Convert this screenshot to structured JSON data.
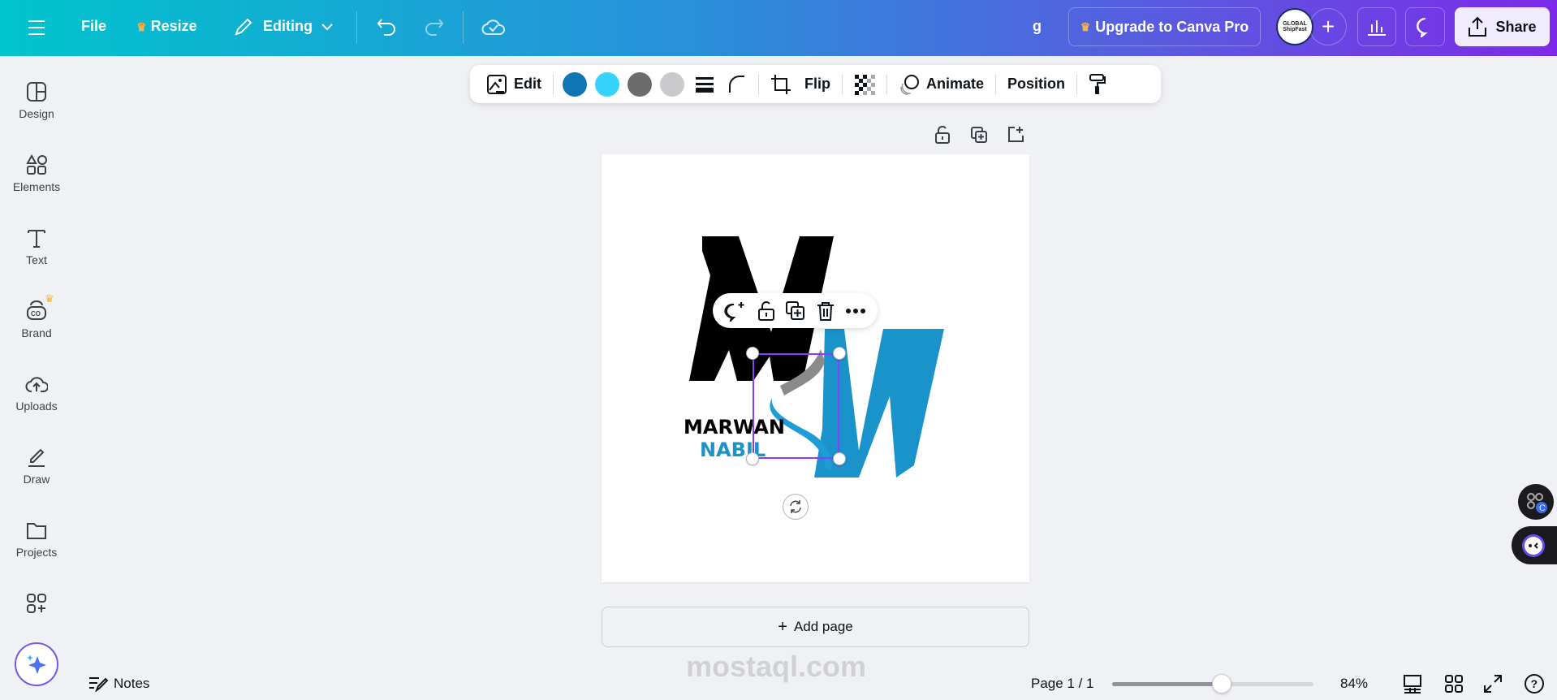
{
  "header": {
    "file": "File",
    "resize": "Resize",
    "editing": "Editing",
    "user_initial": "g",
    "upgrade": "Upgrade to Canva Pro",
    "share": "Share",
    "avatar_text": "GLOBAL ShipFast"
  },
  "sidebar": {
    "items": [
      {
        "label": "Design",
        "icon": "layout-icon"
      },
      {
        "label": "Elements",
        "icon": "shapes-icon"
      },
      {
        "label": "Text",
        "icon": "text-icon"
      },
      {
        "label": "Brand",
        "icon": "brand-icon"
      },
      {
        "label": "Uploads",
        "icon": "upload-cloud-icon"
      },
      {
        "label": "Draw",
        "icon": "draw-icon"
      },
      {
        "label": "Projects",
        "icon": "folder-icon"
      },
      {
        "label": "",
        "icon": "apps-icon"
      }
    ]
  },
  "toolbar": {
    "edit": "Edit",
    "colors": [
      "#0f75b4",
      "#35d3fb",
      "#6b6b6b",
      "#c9c9cc"
    ],
    "flip": "Flip",
    "animate": "Animate",
    "position": "Position"
  },
  "canvas": {
    "logo_line1": "MARWAN",
    "logo_line2": "NABIL",
    "logo_letters": "MN",
    "add_page": "Add page"
  },
  "footer": {
    "notes": "Notes",
    "page": "Page 1 / 1",
    "zoom_percent": 84,
    "zoom_label": "84%"
  },
  "watermark": "mostaql.com",
  "colors": {
    "accent": "#8b3dff",
    "logo_blue": "#1a93cb",
    "selection": "#8b3dff"
  }
}
